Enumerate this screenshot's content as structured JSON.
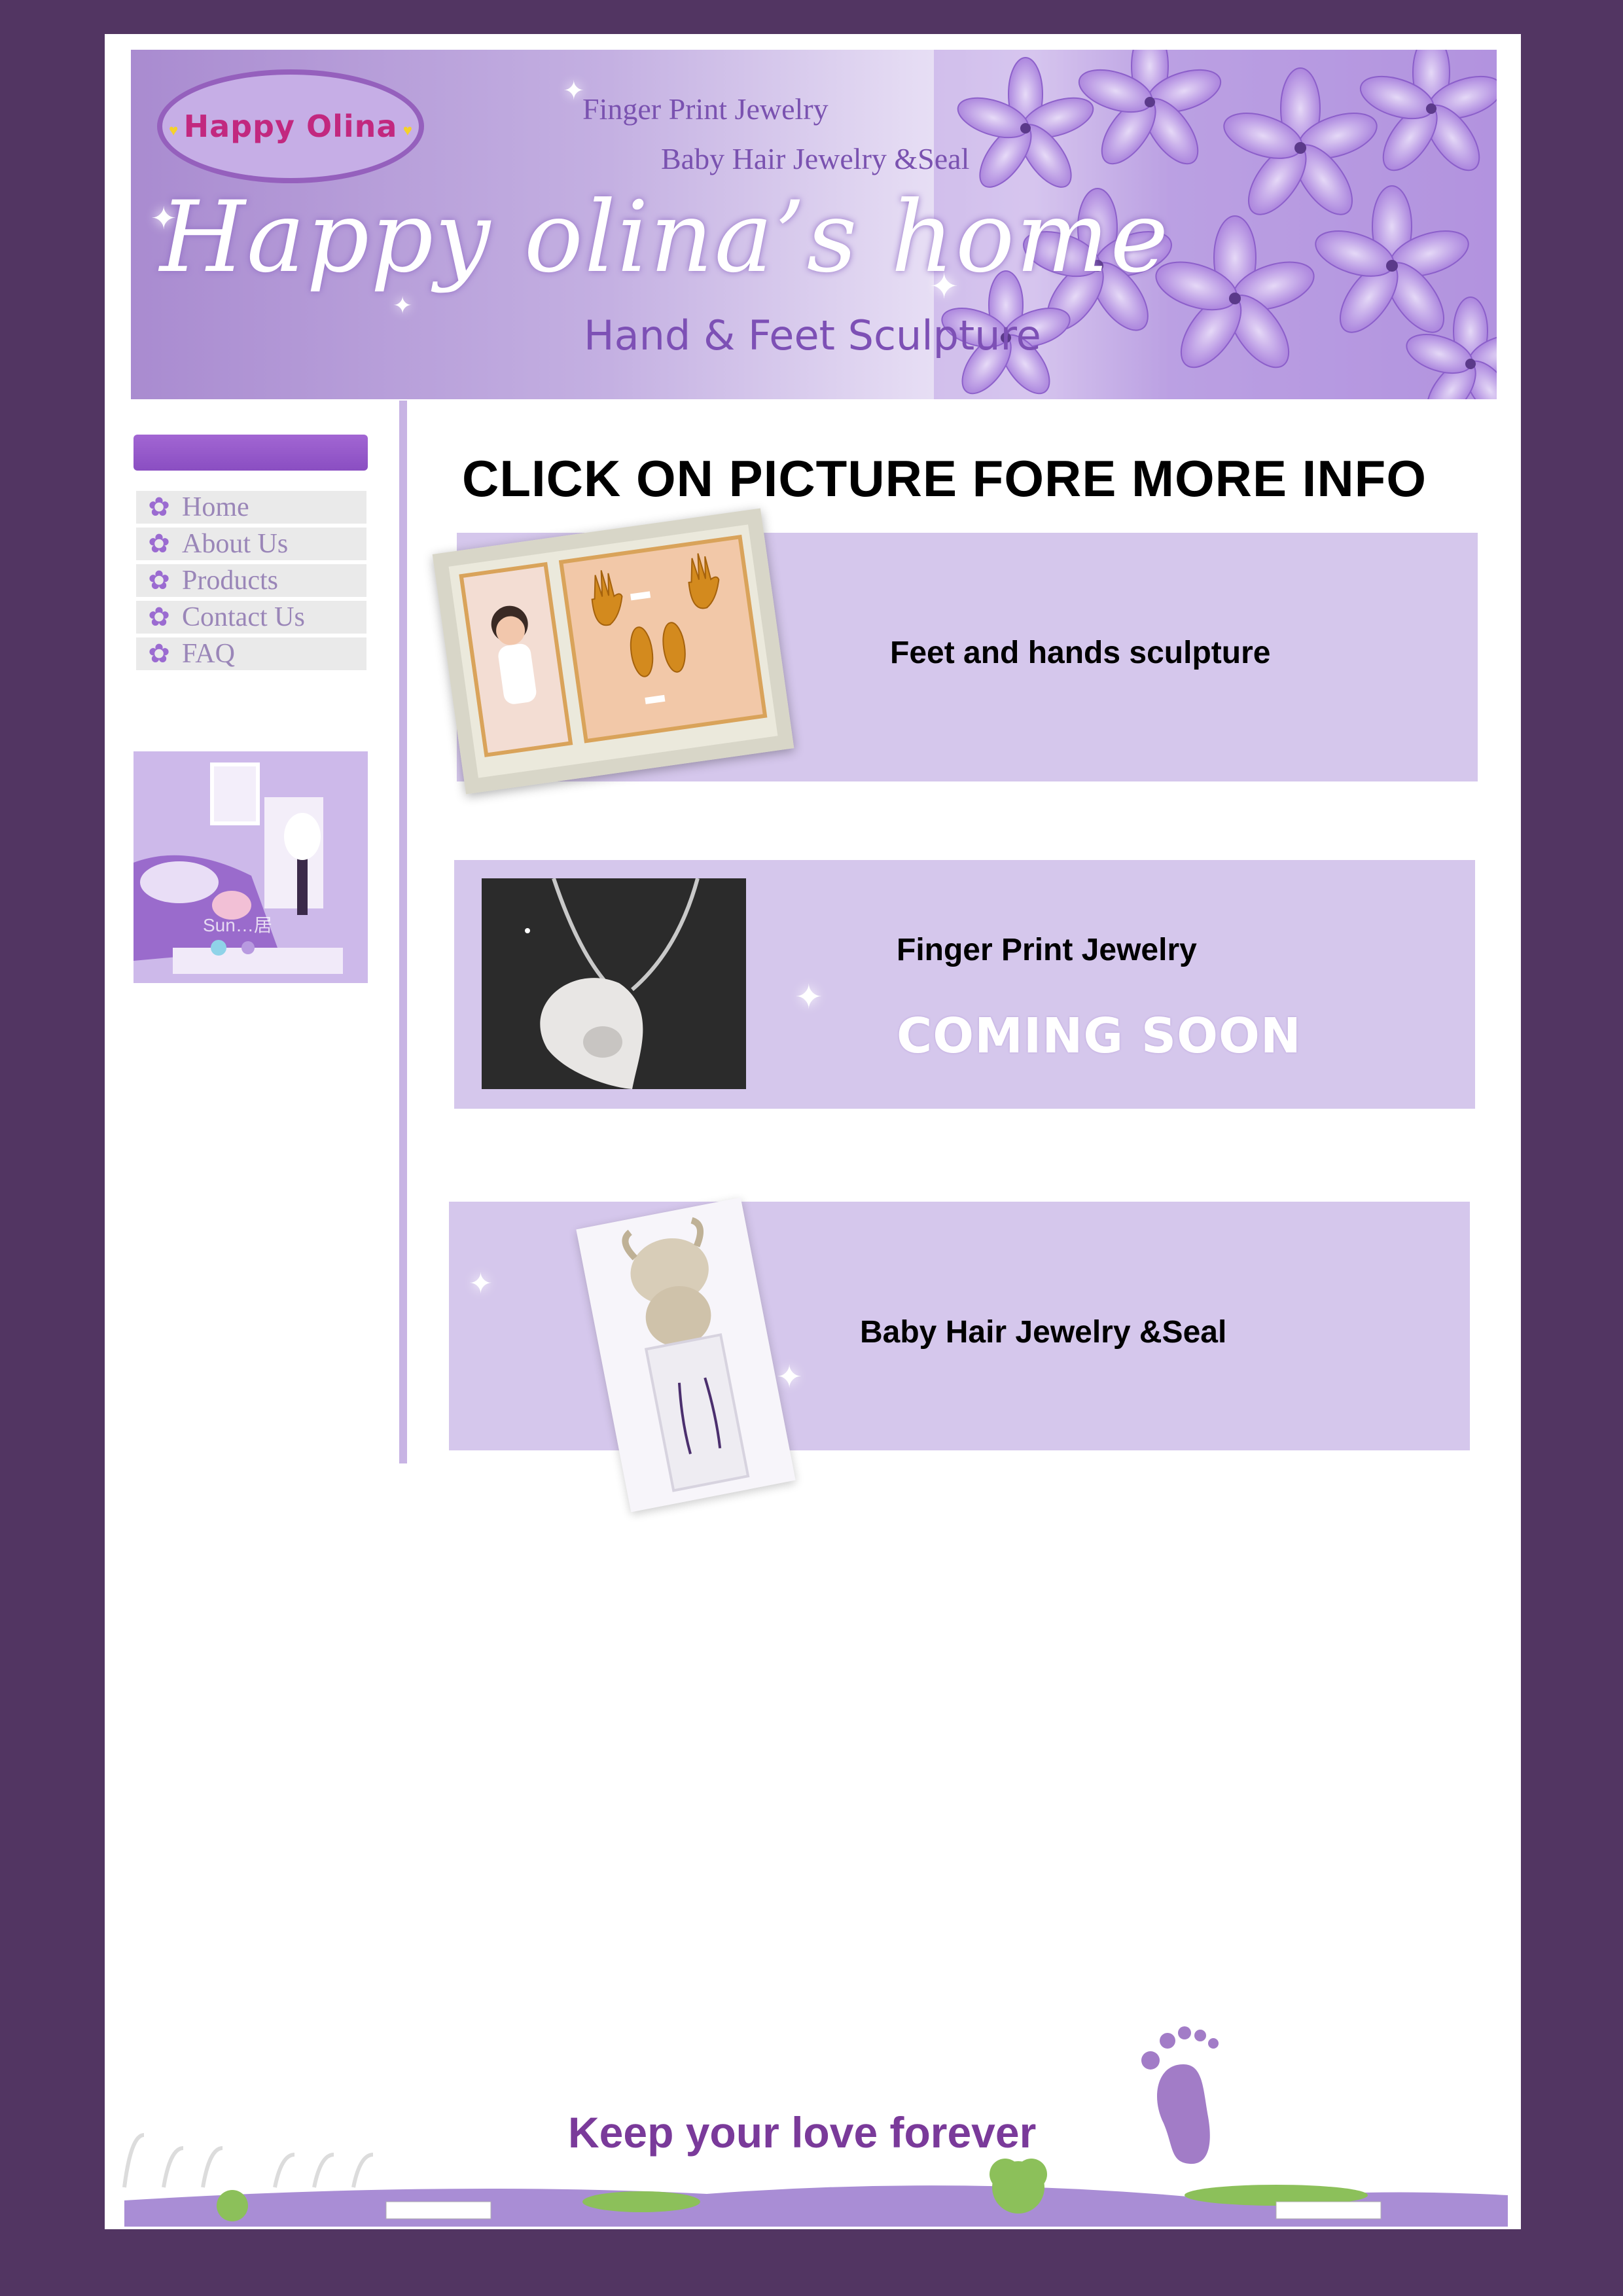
{
  "header": {
    "logo_text": "Happy Olina",
    "line1": "Finger Print Jewelry",
    "line2": "Baby Hair Jewelry &Seal",
    "title": "Happy olina’s home",
    "line3": "Hand & Feet Sculpture"
  },
  "nav": {
    "items": [
      {
        "label": "Home"
      },
      {
        "label": "About Us"
      },
      {
        "label": "Products"
      },
      {
        "label": "Contact Us"
      },
      {
        "label": "FAQ"
      }
    ],
    "icon": "flower-icon"
  },
  "sidebar": {
    "watermark": "Sun…居"
  },
  "main": {
    "headline": "CLICK ON PICTURE FORE MORE INFO",
    "products": [
      {
        "label": "Feet and hands sculpture",
        "image": "hand-feet-frame"
      },
      {
        "label": "Finger Print Jewelry",
        "badge": "COMING SOON",
        "image": "heart-pendant-necklace"
      },
      {
        "label": "Baby Hair Jewelry &Seal",
        "image": "ox-seal-statue"
      }
    ]
  },
  "footer": {
    "slogan": "Keep your love forever"
  },
  "colors": {
    "page_bg": "#523562",
    "panel": "#d5c7ec",
    "accent": "#8a4ec2",
    "slogan": "#7a3a9a"
  }
}
